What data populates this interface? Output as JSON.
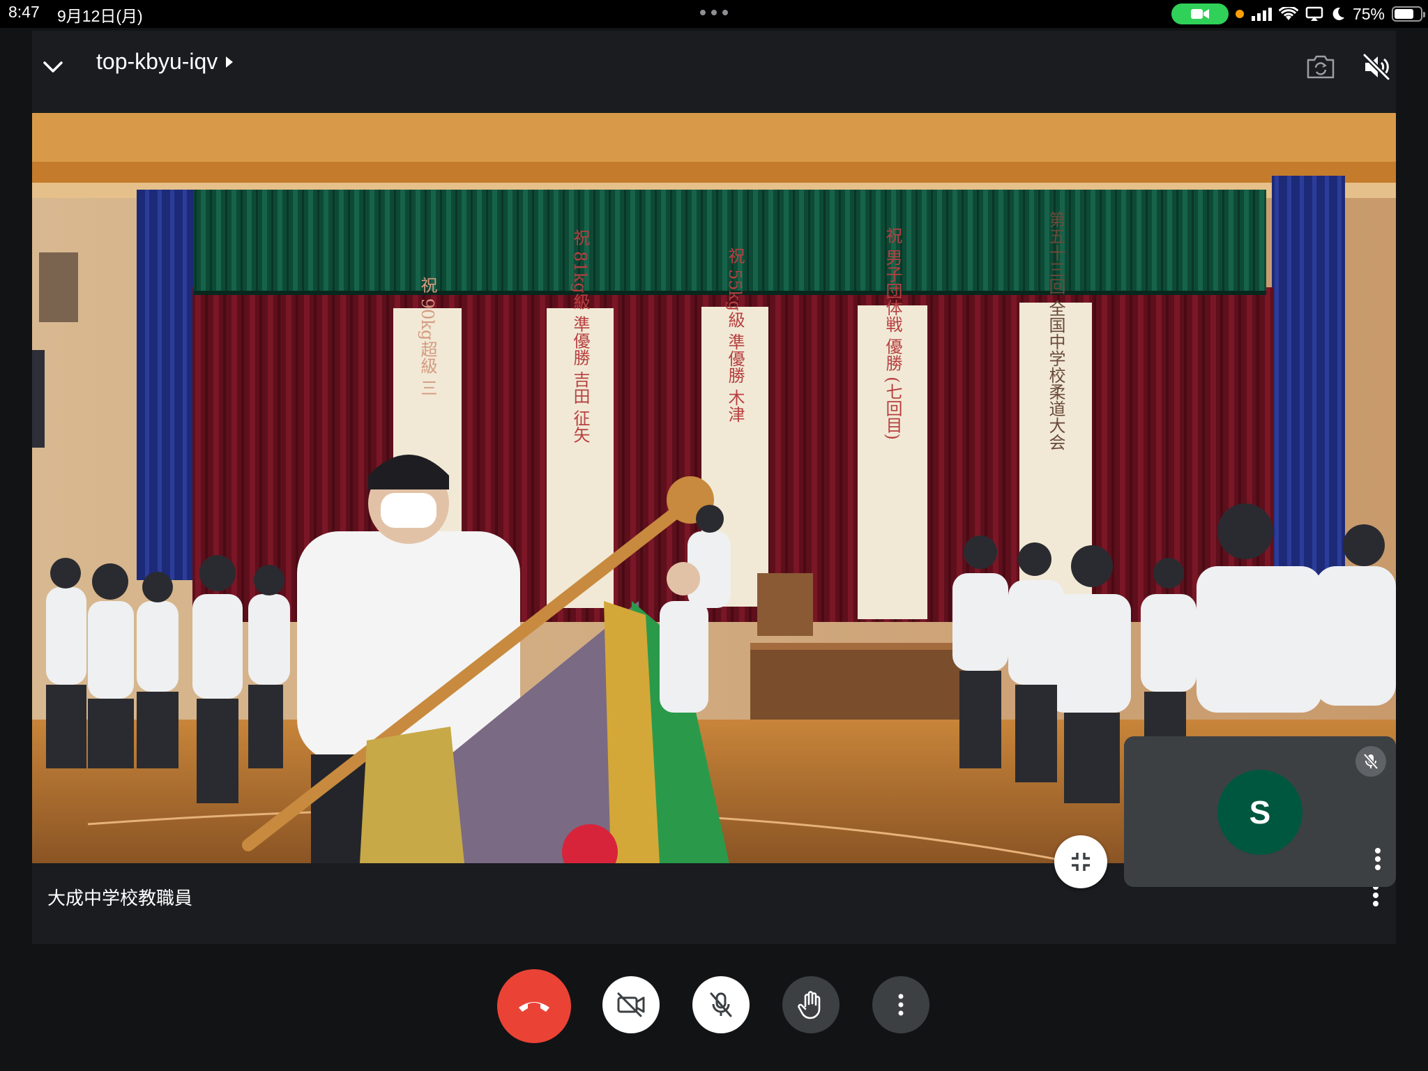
{
  "status_bar": {
    "time": "8:47",
    "date": "9月12日(月)",
    "battery": "75%",
    "battery_level": 0.75,
    "camera_pill_color": "#30d158",
    "indicator_color": "#ff9f0a"
  },
  "meeting": {
    "code": "top-kbyu-iqv"
  },
  "main_participant": {
    "name": "大成中学校教職員"
  },
  "self_view": {
    "initial": "S",
    "avatar_color": "#00573f",
    "muted": true
  },
  "stage_banners": [
    {
      "text": "祝 90kg超級 三"
    },
    {
      "text": "祝 81kg級 準優勝 吉田 征矢"
    },
    {
      "text": "祝 55kg級 準優勝 木津"
    },
    {
      "text": "祝 男子団体戦 優勝 (七回目)"
    },
    {
      "text": "第五十三回 全国中学校柔道大会"
    }
  ],
  "controls": {
    "end_call_color": "#ea4335",
    "icons": [
      "end-call-icon",
      "camera-off-icon",
      "mic-off-icon",
      "raise-hand-icon",
      "more-vert-icon"
    ]
  },
  "header_icons": [
    "switch-camera-icon",
    "speaker-off-icon"
  ]
}
